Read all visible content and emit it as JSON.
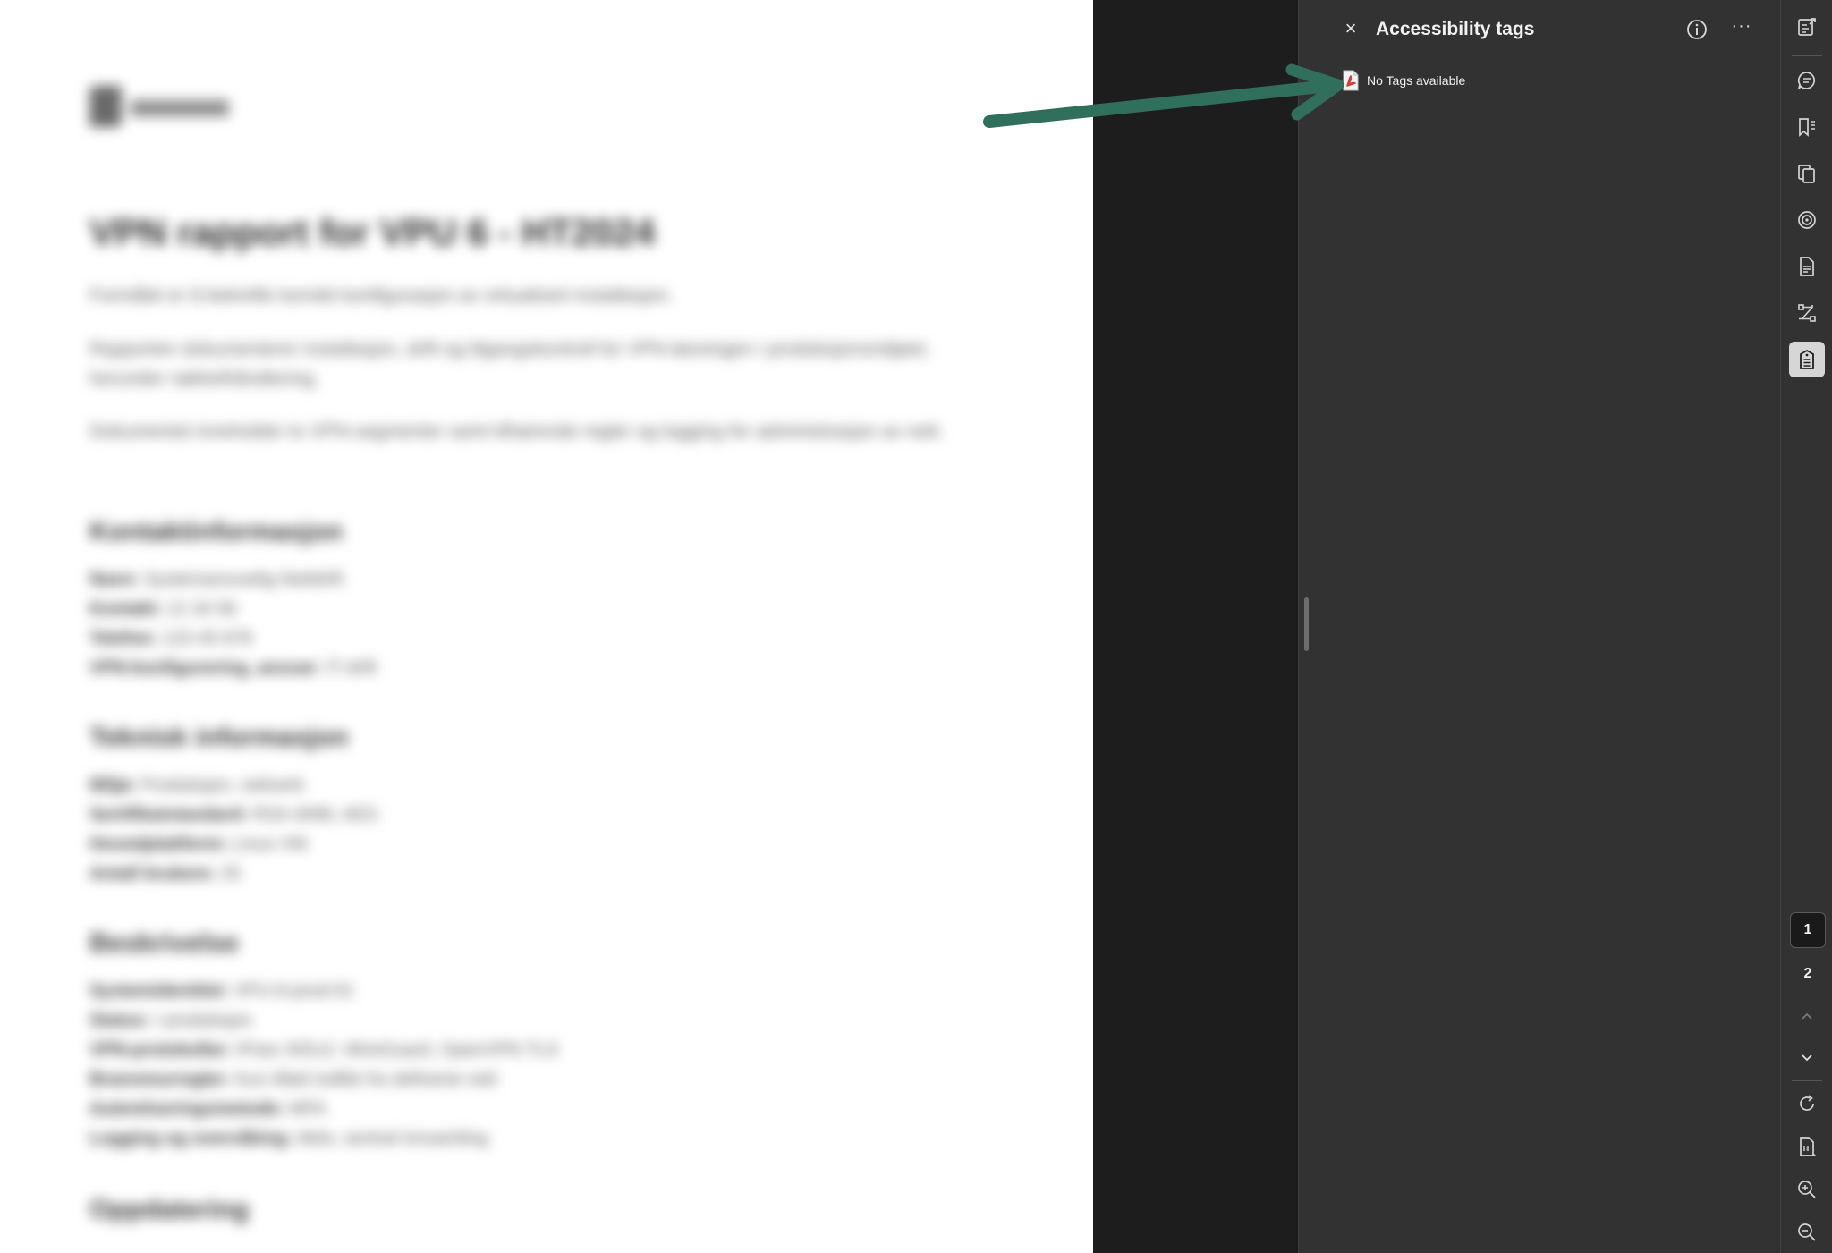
{
  "document": {
    "title": "VPN rapport for VPU 6 - HT2024",
    "intro": "Formålet er å bekrefte korrekt konfigurasjon av virtualisert installasjon.",
    "paragraph_1": "Rapporten dokumenterer installasjon, drift og tilgangskontroll for VPN-løsningen i produksjonsmiljøet, herunder nøkkelhåndtering.",
    "paragraph_2": "Dokumentet inneholder to VPN-segmenter samt tilhørende regler og logging for administrasjon av nett.",
    "section_1": {
      "heading": "Kontaktinformasjon",
      "lines": [
        {
          "key": "Navn:",
          "value": "Systemansvarlig Nettdrift"
        },
        {
          "key": "Kontakt:",
          "value": "12 34 56"
        },
        {
          "key": "Telefon:",
          "value": "123 45 678"
        },
        {
          "key": "VPN-konfigurering, ansvar:",
          "value": "IT-drift"
        }
      ]
    },
    "section_2": {
      "heading": "Teknisk informasjon",
      "lines": [
        {
          "key": "Miljø:",
          "value": "Produksjon, nettverk"
        },
        {
          "key": "Sertifikatstandard:",
          "value": "RSA 4096, AES"
        },
        {
          "key": "Hovedplattform:",
          "value": "Linux VM"
        },
        {
          "key": "Antall brukere:",
          "value": "25"
        }
      ]
    },
    "section_3": {
      "heading": "Beskrivelse",
      "lines": [
        {
          "key": "Systemidentitet:",
          "value": "VPU-6-prod-01"
        },
        {
          "key": "Status:",
          "value": "I produksjon"
        },
        {
          "key": "VPN-protokoller:",
          "value": "IPsec IKEv2, WireGuard, OpenVPN TLS"
        },
        {
          "key": "Brannmurregler:",
          "value": "Kun tillatt trafikk fra definerte nett"
        },
        {
          "key": "Autentiseringsmetode:",
          "value": "MFA"
        },
        {
          "key": "Logging og overvåking:",
          "value": "Aktiv, sentral innsamling"
        }
      ]
    },
    "section_4": {
      "heading": "Oppdatering"
    }
  },
  "panel": {
    "title": "Accessibility tags",
    "close_label": "×",
    "more_label": "···",
    "empty_message": "No Tags available"
  },
  "toolbar": {
    "icons": [
      "edit-pdf-icon",
      "comment-icon",
      "bookmarks-icon",
      "pages-icon",
      "layers-icon",
      "document-properties-icon",
      "order-icon",
      "accessibility-tags-icon"
    ],
    "active_icon": "accessibility-tags-icon",
    "pages": [
      "1",
      "2"
    ],
    "current_page": "1"
  },
  "colors": {
    "panel_bg": "#323232",
    "gutter_bg": "#1d1d1d",
    "arrow": "#2f6f5c",
    "pdf_icon": "#d83b2f"
  }
}
